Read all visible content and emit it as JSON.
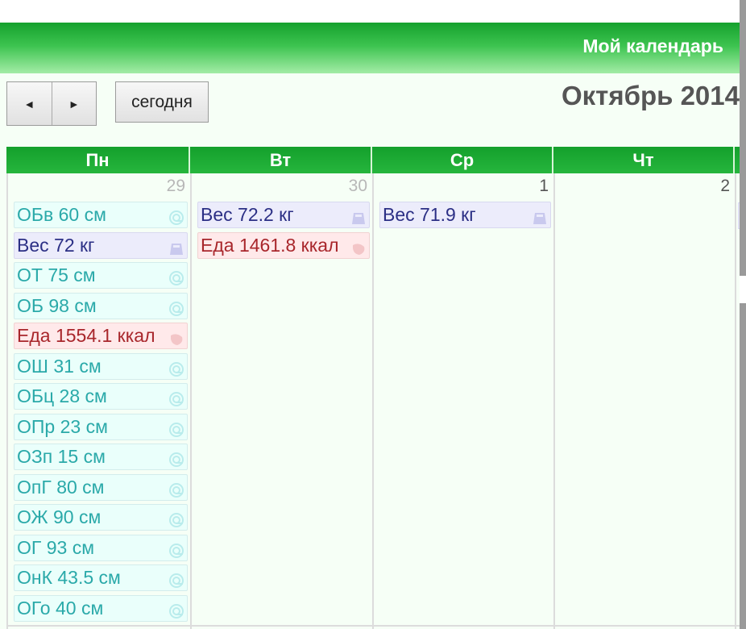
{
  "header": {
    "title": "Мой календарь"
  },
  "nav": {
    "prev_label": "◄",
    "next_label": "►",
    "today_label": "сегодня",
    "month_title": "Октябрь 2014"
  },
  "weekdays": [
    "Пн",
    "Вт",
    "Ср",
    "Чт",
    ""
  ],
  "days": [
    {
      "number": "29",
      "events": [
        {
          "label": "ОБв 60 см",
          "kind": "measure",
          "icon": "tape-measure-icon"
        },
        {
          "label": "Вес 72 кг",
          "kind": "weight",
          "icon": "scale-icon"
        },
        {
          "label": "ОТ 75 см",
          "kind": "measure",
          "icon": "tape-measure-icon"
        },
        {
          "label": "ОБ 98 см",
          "kind": "measure",
          "icon": "tape-measure-icon"
        },
        {
          "label": "Еда 1554.1 ккал",
          "kind": "food",
          "icon": "food-icon"
        },
        {
          "label": "ОШ 31 см",
          "kind": "measure",
          "icon": "tape-measure-icon"
        },
        {
          "label": "ОБц 28 см",
          "kind": "measure",
          "icon": "tape-measure-icon"
        },
        {
          "label": "ОПр 23 см",
          "kind": "measure",
          "icon": "tape-measure-icon"
        },
        {
          "label": "ОЗп 15 см",
          "kind": "measure",
          "icon": "tape-measure-icon"
        },
        {
          "label": "ОпГ 80 см",
          "kind": "measure",
          "icon": "tape-measure-icon"
        },
        {
          "label": "ОЖ 90 см",
          "kind": "measure",
          "icon": "tape-measure-icon"
        },
        {
          "label": "ОГ 93 см",
          "kind": "measure",
          "icon": "tape-measure-icon"
        },
        {
          "label": "ОнК 43.5 см",
          "kind": "measure",
          "icon": "tape-measure-icon"
        },
        {
          "label": "ОГо 40 см",
          "kind": "measure",
          "icon": "tape-measure-icon"
        }
      ]
    },
    {
      "number": "30",
      "events": [
        {
          "label": "Вес 72.2 кг",
          "kind": "weight",
          "icon": "scale-icon"
        },
        {
          "label": "Еда 1461.8 ккал",
          "kind": "food",
          "icon": "food-icon"
        }
      ]
    },
    {
      "number": "1",
      "events": [
        {
          "label": "Вес 71.9 кг",
          "kind": "weight",
          "icon": "scale-icon"
        }
      ]
    },
    {
      "number": "2",
      "events": []
    }
  ],
  "colors": {
    "header_green": "#15a12d",
    "measure_text": "#2aa9a9",
    "weight_text": "#2b2f85",
    "food_text": "#a8262b"
  }
}
